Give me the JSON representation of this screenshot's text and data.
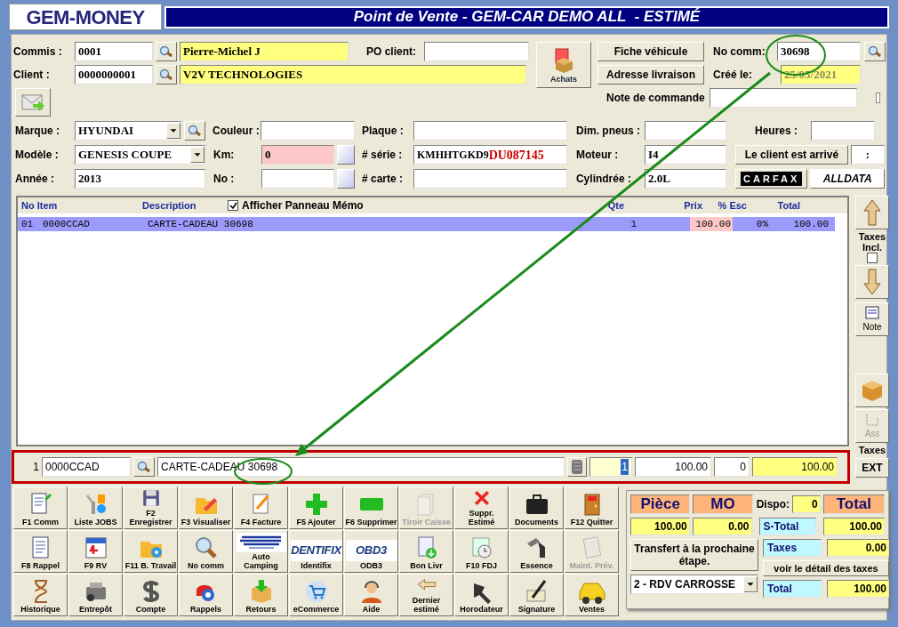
{
  "logo": "GEM-MONEY",
  "title": "Point de Vente - GEM-CAR DEMO ALL  - ESTIMÉ",
  "header": {
    "commis": {
      "label": "Commis :",
      "code": "0001",
      "name": "Pierre-Michel J"
    },
    "client": {
      "label": "Client :",
      "code": "0000000001",
      "name": "V2V TECHNOLOGIES"
    },
    "po_client": {
      "label": "PO client:"
    },
    "achats_button": "Achats",
    "fiche_button": "Fiche véhicule",
    "adresse_button": "Adresse livraison",
    "no_comm": {
      "label": "No comm:",
      "value": "30698"
    },
    "cree_le": {
      "label": "Créé le:",
      "value": "25/05/2021"
    },
    "note": {
      "label": "Note de commande"
    }
  },
  "vehicle": {
    "marque": {
      "label": "Marque :",
      "value": "HYUNDAI"
    },
    "couleur": {
      "label": "Couleur :"
    },
    "plaque": {
      "label": "Plaque :"
    },
    "dim_pneus": {
      "label": "Dim. pneus :"
    },
    "heures": {
      "label": "Heures :"
    },
    "modele": {
      "label": "Modèle :",
      "value": "GENESIS COUPE"
    },
    "km": {
      "label": "Km:",
      "value": "0"
    },
    "serie": {
      "label": "# série :",
      "value": "KMHHTGKD9",
      "value_highlight": "DU087145"
    },
    "moteur": {
      "label": "Moteur :",
      "value": "I4"
    },
    "arrive_button": "Le client est arrivé",
    "arrive_field": ":",
    "annee": {
      "label": "Année :",
      "value": "2013"
    },
    "no": {
      "label": "No :"
    },
    "carte": {
      "label": "# carte :"
    },
    "cylindree": {
      "label": "Cylindrée :",
      "value": "2.0L"
    },
    "carfax": "CARFAX",
    "alldata": "ALLDATA"
  },
  "items": {
    "columns": [
      "No Item",
      "Description",
      "Qte",
      "Prix",
      "% Esc",
      "Total"
    ],
    "memo": {
      "label": "Afficher Panneau Mémo",
      "checked": true
    },
    "rows": [
      {
        "no": "01",
        "item": "0000CCAD",
        "description": "CARTE-CADEAU 30698",
        "qty": "1",
        "price": "100.00",
        "discount": "0%",
        "total": "100.00",
        "selected": true
      }
    ]
  },
  "side": {
    "taxes_incl": {
      "label": "Taxes Incl.",
      "checked": false
    },
    "note_button": "Note",
    "ass_button": {
      "label": "Ass",
      "disabled": true
    },
    "taxes_label": "Taxes",
    "ext_button": "EXT"
  },
  "entry": {
    "line": "1",
    "item": "0000CCAD",
    "description": "CARTE-CADEAU 30698",
    "qty": "1",
    "price": "100.00",
    "discount": "0",
    "total": "100.00"
  },
  "function_buttons": [
    {
      "label": "F1 Comm",
      "disabled": false
    },
    {
      "label": "Liste JOBS",
      "disabled": false
    },
    {
      "label": "F2 Enregistrer",
      "disabled": false
    },
    {
      "label": "F3 Visualiser",
      "disabled": false
    },
    {
      "label": "F4 Facture",
      "disabled": false
    },
    {
      "label": "F5 Ajouter",
      "disabled": false
    },
    {
      "label": "F6 Supprimer",
      "disabled": false
    },
    {
      "label": "Tiroir Caisse",
      "disabled": true
    },
    {
      "label": "Suppr. Estimé",
      "disabled": false
    },
    {
      "label": "Documents",
      "disabled": false
    },
    {
      "label": "F12 Quitter",
      "disabled": false
    },
    {
      "label": "F8 Rappel",
      "disabled": false
    },
    {
      "label": "F9 RV",
      "disabled": false
    },
    {
      "label": "F11 B. Travail",
      "disabled": false
    },
    {
      "label": "No comm",
      "disabled": false
    },
    {
      "label": "Auto Camping",
      "disabled": false
    },
    {
      "label": "Identifix",
      "disabled": false,
      "logo": "DENTIFIX"
    },
    {
      "label": "ODB3",
      "disabled": false,
      "logo": "OBD3"
    },
    {
      "label": "Bon Livr",
      "disabled": false
    },
    {
      "label": "F10 FDJ",
      "disabled": false
    },
    {
      "label": "Essence",
      "disabled": false
    },
    {
      "label": "Maint. Prév.",
      "disabled": true
    },
    {
      "label": "Historique",
      "disabled": false
    },
    {
      "label": "Entrepôt",
      "disabled": false
    },
    {
      "label": "Compte",
      "disabled": false
    },
    {
      "label": "Rappels",
      "disabled": false
    },
    {
      "label": "Retours",
      "disabled": false
    },
    {
      "label": "eCommerce",
      "disabled": false
    },
    {
      "label": "Aide",
      "disabled": false
    },
    {
      "label": "Dernier estimé",
      "disabled": false
    },
    {
      "label": "Horodateur",
      "disabled": false
    },
    {
      "label": "Signature",
      "disabled": false
    },
    {
      "label": "Ventes",
      "disabled": false
    }
  ],
  "totals": {
    "piece_label": "Pièce",
    "mo_label": "MO",
    "dispo": {
      "label": "Dispo:",
      "value": "0"
    },
    "total_label": "Total",
    "piece": "100.00",
    "mo": "0.00",
    "stotal": {
      "label": "S-Total",
      "value": "100.00"
    },
    "taxes": {
      "label": "Taxes",
      "value": "0.00"
    },
    "total": {
      "label": "Total",
      "value": "100.00"
    },
    "transfer_button": "Transfert à la prochaine étape.",
    "detail_button": "voir le détail des taxes",
    "stage_select": "2 - RDV CARROSSE"
  }
}
